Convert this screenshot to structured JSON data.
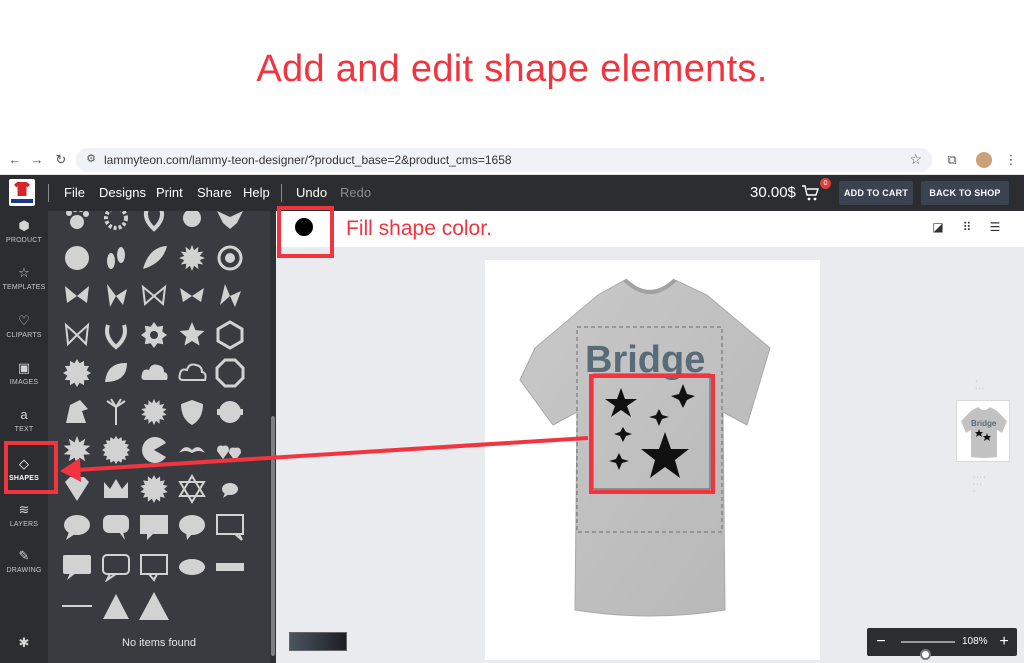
{
  "headline": "Add and edit shape elements.",
  "browser": {
    "url": "lammyteon.com/lammy-teon-designer/?product_base=2&product_cms=1658"
  },
  "appbar": {
    "menu": [
      "File",
      "Designs",
      "Print",
      "Share",
      "Help"
    ],
    "undo": "Undo",
    "redo": "Redo",
    "price": "30.00$",
    "cart_count": "0",
    "add_to_cart": "ADD TO CART",
    "back_to_shop": "BACK TO SHOP"
  },
  "sidebar": {
    "items": [
      {
        "label": "PRODUCT",
        "icon": "cube-icon"
      },
      {
        "label": "TEMPLATES",
        "icon": "star-icon"
      },
      {
        "label": "CLIPARTS",
        "icon": "heart-icon"
      },
      {
        "label": "IMAGES",
        "icon": "image-icon"
      },
      {
        "label": "TEXT",
        "icon": "text-icon"
      },
      {
        "label": "SHAPES",
        "icon": "diamond-icon"
      },
      {
        "label": "LAYERS",
        "icon": "layers-icon"
      },
      {
        "label": "DRAWING",
        "icon": "pencil-icon"
      }
    ],
    "active": "SHAPES"
  },
  "panel": {
    "empty_text": "No items found"
  },
  "toolbar": {
    "fill_label": "Fill shape color.",
    "fill_color": "#000000"
  },
  "design": {
    "text": "Bridge",
    "text_color": "#5a6b78"
  },
  "zoom": {
    "minus": "−",
    "plus": "+",
    "value": "108%",
    "level": 0.45
  },
  "colors": {
    "accent": "#f2343f",
    "dark": "#2b2d31",
    "panel": "#393b40"
  }
}
